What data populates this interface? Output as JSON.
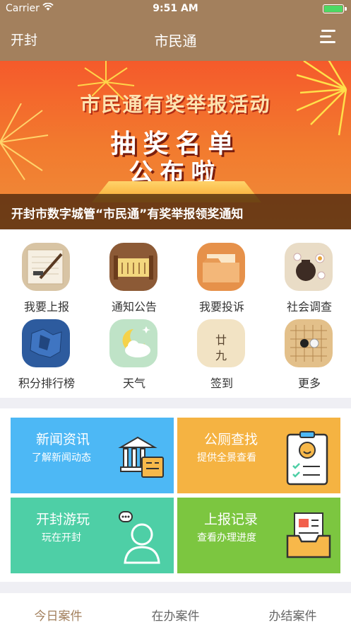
{
  "status": {
    "carrier": "Carrier",
    "time": "9:51 AM"
  },
  "nav": {
    "city": "开封",
    "title": "市民通",
    "menu_icon": "hamburger-menu-icon"
  },
  "banner": {
    "line1": "市民通有奖举报活动",
    "line2": "抽奖名单",
    "line3": "公布啦",
    "caption": "开封市数字城管“市民通”有奖举报领奖通知"
  },
  "grid": [
    {
      "label": "我要上报",
      "icon": "brush-paper-icon"
    },
    {
      "label": "通知公告",
      "icon": "scroll-icon"
    },
    {
      "label": "我要投诉",
      "icon": "folder-icon"
    },
    {
      "label": "社会调查",
      "icon": "tea-set-icon"
    },
    {
      "label": "积分排行榜",
      "icon": "map-icon"
    },
    {
      "label": "天气",
      "icon": "moon-cloud-icon"
    },
    {
      "label": "签到",
      "icon": "calendar-icon"
    },
    {
      "label": "更多",
      "icon": "go-board-icon"
    }
  ],
  "calendar_text": {
    "top": "廿",
    "bottom": "九"
  },
  "cards": [
    {
      "title": "新闻资讯",
      "subtitle": "了解新闻动态",
      "color": "#4db8f5",
      "icon": "building-news-icon"
    },
    {
      "title": "公厕查找",
      "subtitle": "提供全景查看",
      "color": "#f5b342",
      "icon": "checklist-icon"
    },
    {
      "title": "开封游玩",
      "subtitle": "玩在开封",
      "color": "#4ecfa6",
      "icon": "person-chat-icon"
    },
    {
      "title": "上报记录",
      "subtitle": "查看办理进度",
      "color": "#7cc640",
      "icon": "document-tray-icon"
    }
  ],
  "tabs": [
    "今日案件",
    "在办案件",
    "办结案件"
  ],
  "colors": {
    "header": "#a3805d",
    "background": "#efeff4"
  }
}
